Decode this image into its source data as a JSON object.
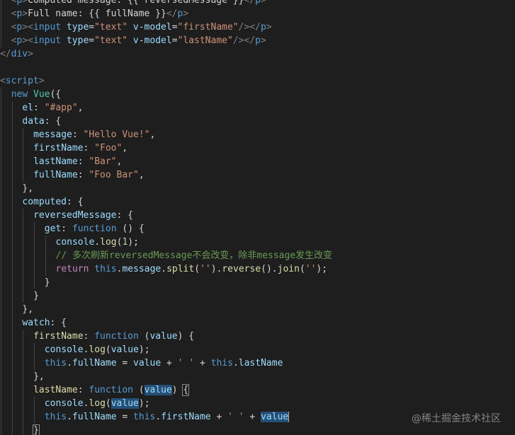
{
  "colors": {
    "background": "#1e1e1e",
    "default": "#d4d4d4",
    "tag": "#569cd6",
    "bracket": "#808080",
    "attr": "#9cdcfe",
    "string": "#ce9178",
    "keyword": "#569cd6",
    "control": "#c586c0",
    "func": "#dcdcaa",
    "class": "#4ec9b0",
    "number": "#b5cea8",
    "comment": "#6a9955",
    "property": "#9cdcfe"
  },
  "code_lines": [
    {
      "indent": 1,
      "tokens": [
        [
          "<",
          "bracket"
        ],
        [
          "p",
          "tag"
        ],
        [
          ">",
          "bracket"
        ],
        [
          "Computed message: {{ reversedMessage }}",
          "default"
        ],
        [
          "</",
          "bracket"
        ],
        [
          "p",
          "tag"
        ],
        [
          ">",
          "bracket"
        ]
      ]
    },
    {
      "indent": 1,
      "tokens": [
        [
          "<",
          "bracket"
        ],
        [
          "p",
          "tag"
        ],
        [
          ">",
          "bracket"
        ],
        [
          "Full name: {{ fullName }}",
          "default"
        ],
        [
          "</",
          "bracket"
        ],
        [
          "p",
          "tag"
        ],
        [
          ">",
          "bracket"
        ]
      ]
    },
    {
      "indent": 1,
      "tokens": [
        [
          "<",
          "bracket"
        ],
        [
          "p",
          "tag"
        ],
        [
          "><",
          "bracket"
        ],
        [
          "input",
          "tag"
        ],
        [
          " ",
          "default"
        ],
        [
          "type",
          "attr"
        ],
        [
          "=",
          "default"
        ],
        [
          "\"text\"",
          "string"
        ],
        [
          " ",
          "default"
        ],
        [
          "v-model",
          "attr"
        ],
        [
          "=",
          "default"
        ],
        [
          "\"firstName\"",
          "string"
        ],
        [
          "/></",
          "bracket"
        ],
        [
          "p",
          "tag"
        ],
        [
          ">",
          "bracket"
        ]
      ]
    },
    {
      "indent": 1,
      "tokens": [
        [
          "<",
          "bracket"
        ],
        [
          "p",
          "tag"
        ],
        [
          "><",
          "bracket"
        ],
        [
          "input",
          "tag"
        ],
        [
          " ",
          "default"
        ],
        [
          "type",
          "attr"
        ],
        [
          "=",
          "default"
        ],
        [
          "\"text\"",
          "string"
        ],
        [
          " ",
          "default"
        ],
        [
          "v-model",
          "attr"
        ],
        [
          "=",
          "default"
        ],
        [
          "\"lastName\"",
          "string"
        ],
        [
          "/></",
          "bracket"
        ],
        [
          "p",
          "tag"
        ],
        [
          ">",
          "bracket"
        ]
      ]
    },
    {
      "indent": 0,
      "tokens": [
        [
          "</",
          "bracket"
        ],
        [
          "div",
          "tag"
        ],
        [
          ">",
          "bracket"
        ]
      ]
    },
    {
      "indent": 0,
      "tokens": []
    },
    {
      "indent": 0,
      "tokens": [
        [
          "<",
          "bracket"
        ],
        [
          "script",
          "tag"
        ],
        [
          ">",
          "bracket"
        ]
      ]
    },
    {
      "indent": 1,
      "tokens": [
        [
          "new",
          "keyword"
        ],
        [
          " ",
          "default"
        ],
        [
          "Vue",
          "class"
        ],
        [
          "({",
          "default"
        ]
      ]
    },
    {
      "indent": 2,
      "tokens": [
        [
          "el",
          "property"
        ],
        [
          ": ",
          "default"
        ],
        [
          "\"#app\"",
          "string"
        ],
        [
          ",",
          "default"
        ]
      ]
    },
    {
      "indent": 2,
      "tokens": [
        [
          "data",
          "property"
        ],
        [
          ": {",
          "default"
        ]
      ]
    },
    {
      "indent": 3,
      "tokens": [
        [
          "message",
          "property"
        ],
        [
          ": ",
          "default"
        ],
        [
          "\"Hello Vue!\"",
          "string"
        ],
        [
          ",",
          "default"
        ]
      ]
    },
    {
      "indent": 3,
      "tokens": [
        [
          "firstName",
          "property"
        ],
        [
          ": ",
          "default"
        ],
        [
          "\"Foo\"",
          "string"
        ],
        [
          ",",
          "default"
        ]
      ]
    },
    {
      "indent": 3,
      "tokens": [
        [
          "lastName",
          "property"
        ],
        [
          ": ",
          "default"
        ],
        [
          "\"Bar\"",
          "string"
        ],
        [
          ",",
          "default"
        ]
      ]
    },
    {
      "indent": 3,
      "tokens": [
        [
          "fullName",
          "property"
        ],
        [
          ": ",
          "default"
        ],
        [
          "\"Foo Bar\"",
          "string"
        ],
        [
          ",",
          "default"
        ]
      ]
    },
    {
      "indent": 2,
      "tokens": [
        [
          "},",
          "default"
        ]
      ]
    },
    {
      "indent": 2,
      "tokens": [
        [
          "computed",
          "property"
        ],
        [
          ": {",
          "default"
        ]
      ]
    },
    {
      "indent": 3,
      "tokens": [
        [
          "reversedMessage",
          "property"
        ],
        [
          ": {",
          "default"
        ]
      ]
    },
    {
      "indent": 4,
      "tokens": [
        [
          "get",
          "property"
        ],
        [
          ": ",
          "default"
        ],
        [
          "function",
          "keyword"
        ],
        [
          " () {",
          "default"
        ]
      ]
    },
    {
      "indent": 5,
      "tokens": [
        [
          "console",
          "property"
        ],
        [
          ".",
          "default"
        ],
        [
          "log",
          "func"
        ],
        [
          "(",
          "default"
        ],
        [
          "1",
          "number"
        ],
        [
          ");",
          "default"
        ]
      ]
    },
    {
      "indent": 5,
      "tokens": [
        [
          "// 多次刷新reversedMessage不会改变，除非message发生改变",
          "comment"
        ]
      ]
    },
    {
      "indent": 5,
      "tokens": [
        [
          "return",
          "control"
        ],
        [
          " ",
          "default"
        ],
        [
          "this",
          "keyword"
        ],
        [
          ".",
          "default"
        ],
        [
          "message",
          "property"
        ],
        [
          ".",
          "default"
        ],
        [
          "split",
          "func"
        ],
        [
          "(",
          "default"
        ],
        [
          "''",
          "string"
        ],
        [
          ").",
          "default"
        ],
        [
          "reverse",
          "func"
        ],
        [
          "().",
          "default"
        ],
        [
          "join",
          "func"
        ],
        [
          "(",
          "default"
        ],
        [
          "''",
          "string"
        ],
        [
          ");",
          "default"
        ]
      ]
    },
    {
      "indent": 4,
      "tokens": [
        [
          "}",
          "default"
        ]
      ]
    },
    {
      "indent": 3,
      "tokens": [
        [
          "}",
          "default"
        ]
      ]
    },
    {
      "indent": 2,
      "tokens": [
        [
          "},",
          "default"
        ]
      ]
    },
    {
      "indent": 2,
      "tokens": [
        [
          "watch",
          "property"
        ],
        [
          ": {",
          "default"
        ]
      ]
    },
    {
      "indent": 3,
      "tokens": [
        [
          "firstName",
          "func"
        ],
        [
          ": ",
          "default"
        ],
        [
          "function",
          "keyword"
        ],
        [
          " (",
          "default"
        ],
        [
          "value",
          "property"
        ],
        [
          ") {",
          "default"
        ]
      ]
    },
    {
      "indent": 4,
      "tokens": [
        [
          "console",
          "property"
        ],
        [
          ".",
          "default"
        ],
        [
          "log",
          "func"
        ],
        [
          "(",
          "default"
        ],
        [
          "value",
          "property"
        ],
        [
          ");",
          "default"
        ]
      ]
    },
    {
      "indent": 4,
      "tokens": [
        [
          "this",
          "keyword"
        ],
        [
          ".",
          "default"
        ],
        [
          "fullName",
          "property"
        ],
        [
          " = ",
          "default"
        ],
        [
          "value",
          "property"
        ],
        [
          " + ",
          "default"
        ],
        [
          "' '",
          "string"
        ],
        [
          " + ",
          "default"
        ],
        [
          "this",
          "keyword"
        ],
        [
          ".",
          "default"
        ],
        [
          "lastName",
          "property"
        ]
      ]
    },
    {
      "indent": 3,
      "tokens": [
        [
          "},",
          "default"
        ]
      ]
    },
    {
      "indent": 3,
      "tokens": [
        [
          "lastName",
          "func"
        ],
        [
          ": ",
          "default"
        ],
        [
          "function",
          "keyword"
        ],
        [
          " (",
          "default"
        ],
        [
          "value",
          "property",
          "hl"
        ],
        [
          ") ",
          "default"
        ],
        [
          "{",
          "default",
          "box"
        ]
      ]
    },
    {
      "indent": 4,
      "tokens": [
        [
          "console",
          "property"
        ],
        [
          ".",
          "default"
        ],
        [
          "log",
          "func"
        ],
        [
          "(",
          "default"
        ],
        [
          "value",
          "property",
          "hl"
        ],
        [
          ");",
          "default"
        ]
      ]
    },
    {
      "indent": 4,
      "tokens": [
        [
          "this",
          "keyword"
        ],
        [
          ".",
          "default"
        ],
        [
          "fullName",
          "property"
        ],
        [
          " = ",
          "default"
        ],
        [
          "this",
          "keyword"
        ],
        [
          ".",
          "default"
        ],
        [
          "firstName",
          "property"
        ],
        [
          " + ",
          "default"
        ],
        [
          "' '",
          "string"
        ],
        [
          " + ",
          "default"
        ],
        [
          "value",
          "property",
          "hl"
        ],
        [
          "",
          "cursor"
        ]
      ]
    },
    {
      "indent": 3,
      "tokens": [
        [
          "}",
          "default",
          "box"
        ]
      ]
    }
  ],
  "watermark": "@稀土掘金技术社区"
}
